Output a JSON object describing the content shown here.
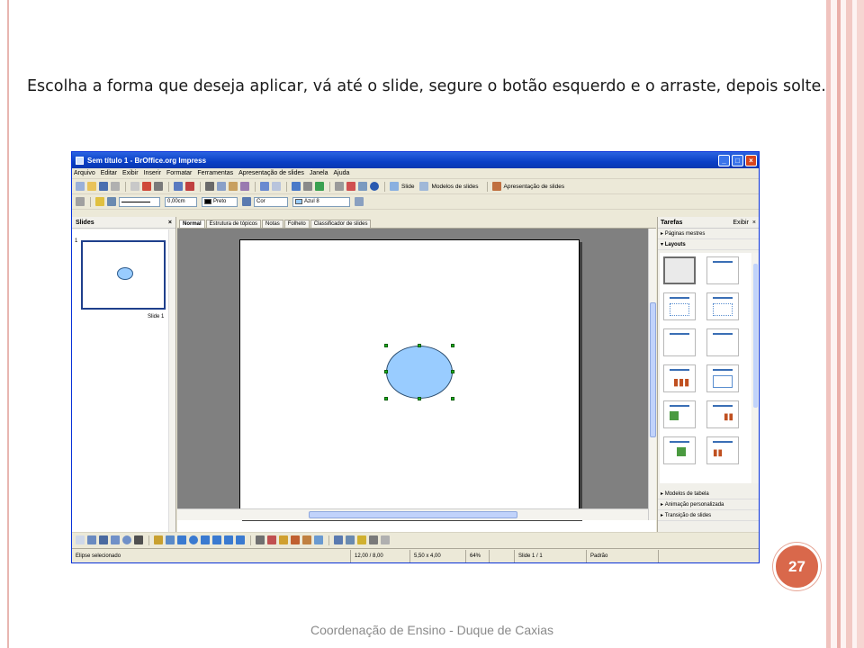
{
  "instruction": "Escolha a forma que deseja aplicar, vá até o slide, segure o botão esquerdo e o arraste, depois solte.",
  "page_number": "27",
  "footer": "Coordenação de Ensino - Duque de Caxias",
  "window": {
    "title": "Sem título 1 - BrOffice.org Impress",
    "menu": [
      "Arquivo",
      "Editar",
      "Exibir",
      "Inserir",
      "Formatar",
      "Ferramentas",
      "Apresentação de slides",
      "Janela",
      "Ajuda"
    ],
    "toolbar": {
      "slide_label": "Slide",
      "templates_label": "Modelos de slides",
      "presentation_label": "Apresentação de slides"
    },
    "line_toolbar": {
      "line_width": "0,00cm",
      "line_color": "Preto",
      "area_style": "Cor",
      "area_color": "Azul 8",
      "line_color_hex": "#000000",
      "area_color_hex": "#99ccff"
    },
    "slides_pane": {
      "title": "Slides",
      "thumb_number": "1",
      "thumb_label": "Slide 1"
    },
    "tabs": [
      "Normal",
      "Estrutura de tópicos",
      "Notas",
      "Folheto",
      "Classificador de slides"
    ],
    "tasks_pane": {
      "title": "Tarefas",
      "view_label": "Exibir",
      "sections_top": [
        "Páginas mestres",
        "Layouts"
      ],
      "sections_bottom": [
        "Modelos de tabela",
        "Animação personalizada",
        "Transição de slides"
      ]
    },
    "status": {
      "selection": "Elipse selecionado",
      "position": "12,00 / 8,00",
      "size": "5,50 x 4,00",
      "zoom": "64%",
      "slide": "Slide 1 / 1",
      "layout": "Padrão"
    }
  }
}
